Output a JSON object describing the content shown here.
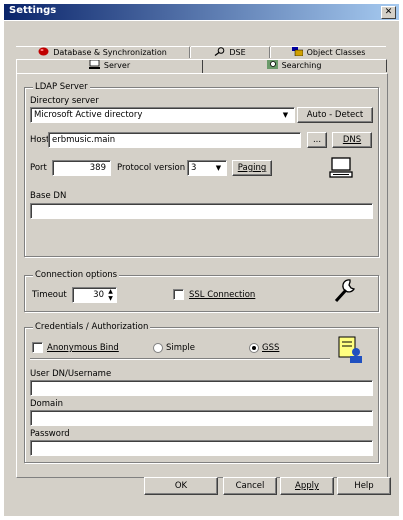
{
  "window": {
    "title": "Settings"
  },
  "tabs": {
    "row1": [
      {
        "label": "Database & Synchronization",
        "icon": "database-icon"
      },
      {
        "label": "DSE",
        "icon": "search-key-icon"
      },
      {
        "label": "Object Classes",
        "icon": "object-classes-icon"
      }
    ],
    "row2": [
      {
        "label": "Server",
        "icon": "server-icon",
        "active": true
      },
      {
        "label": "Searching",
        "icon": "searching-icon"
      }
    ]
  },
  "ldap": {
    "legend": "LDAP Server",
    "directory_label": "Directory server",
    "directory_value": "Microsoft Active directory",
    "auto_detect": "Auto - Detect",
    "host_label": "Host",
    "host_value": "erbmusic.main",
    "browse": "...",
    "dns": "DNS",
    "port_label": "Port",
    "port_value": "389",
    "protocol_label": "Protocol version",
    "protocol_value": "3",
    "paging": "Paging",
    "basedn_label": "Base DN",
    "basedn_value": ""
  },
  "connection": {
    "legend": "Connection options",
    "timeout_label": "Timeout",
    "timeout_value": "30",
    "ssl_label": "SSL Connection",
    "ssl_checked": false
  },
  "credentials": {
    "legend": "Credentials / Authorization",
    "anonymous_label": "Anonymous Bind",
    "anonymous_checked": false,
    "simple_label": "Simple",
    "gss_label": "GSS",
    "selected": "GSS",
    "user_label": "User DN/Username",
    "user_value": "",
    "domain_label": "Domain",
    "domain_value": "",
    "password_label": "Password",
    "password_value": ""
  },
  "buttons": {
    "ok": "OK",
    "cancel": "Cancel",
    "apply": "Apply",
    "help": "Help"
  }
}
